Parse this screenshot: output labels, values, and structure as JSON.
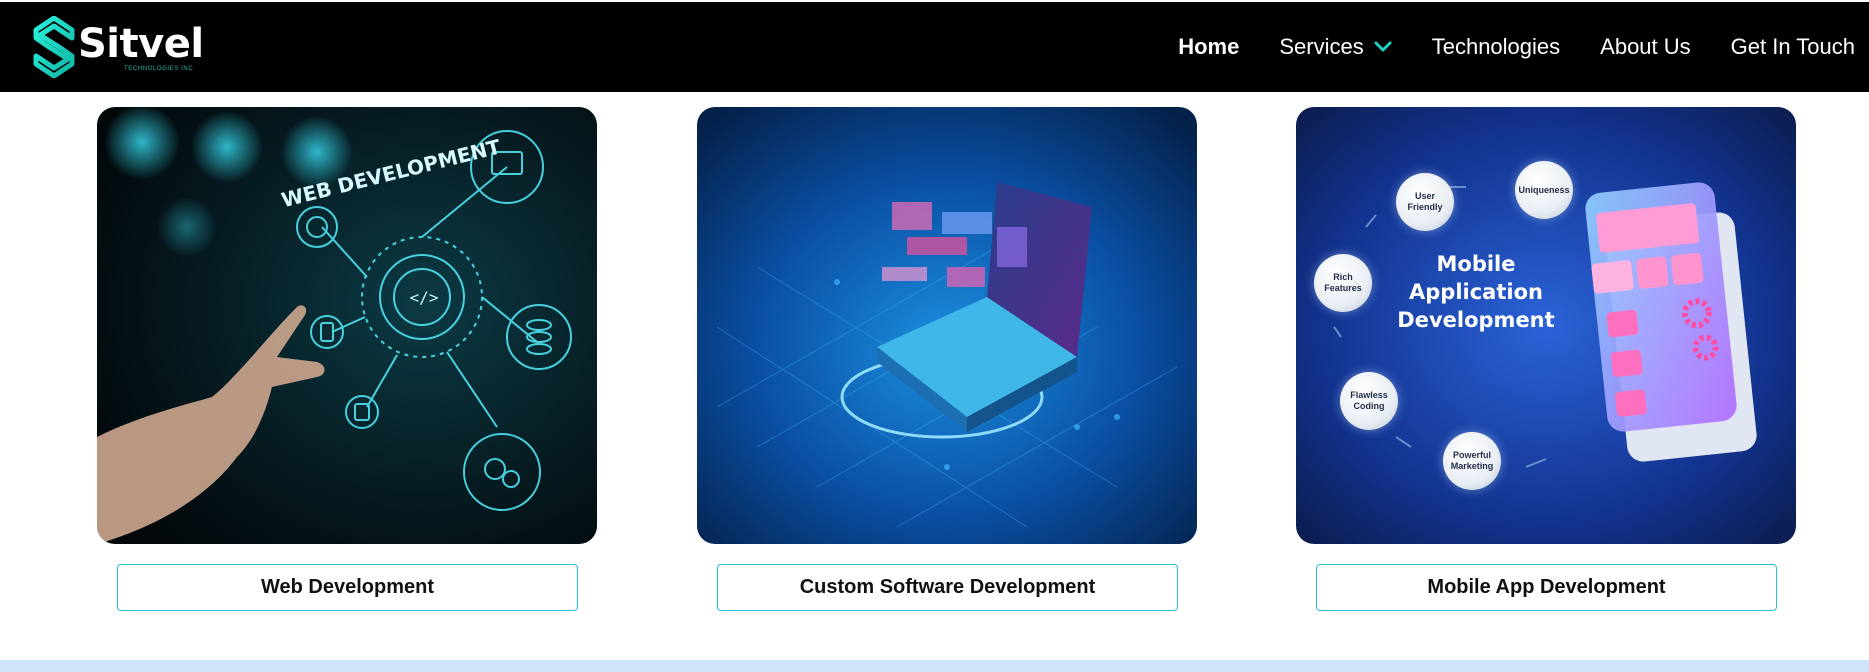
{
  "brand": {
    "name": "Sitvel",
    "tagline": "TECHNOLOGIES INC",
    "accent_color": "#1fd1c1"
  },
  "nav": {
    "items": [
      {
        "label": "Home",
        "active": true
      },
      {
        "label": "Services",
        "has_dropdown": true
      },
      {
        "label": "Technologies"
      },
      {
        "label": "About Us"
      },
      {
        "label": "Get In Touch"
      }
    ]
  },
  "services": [
    {
      "title": "Web Development",
      "image": {
        "text": "WEB DEVELOPMENT",
        "icons": [
          "laptop-icon",
          "globe-icon",
          "code-gear-icon",
          "database-icon",
          "gears-icon",
          "tablet-icon",
          "mobile-icon"
        ]
      }
    },
    {
      "title": "Custom Software Development",
      "image": {
        "text": ""
      }
    },
    {
      "title": "Mobile App Development",
      "image": {
        "heading": "Mobile Application Development",
        "bubbles": [
          "User Friendly",
          "Uniqueness",
          "Rich Features",
          "Flawless Coding",
          "Powerful Marketing"
        ]
      }
    }
  ],
  "colors": {
    "navbar_bg": "#000000",
    "button_border": "#27c2d6",
    "bottom_band": "#cfe3fb"
  }
}
